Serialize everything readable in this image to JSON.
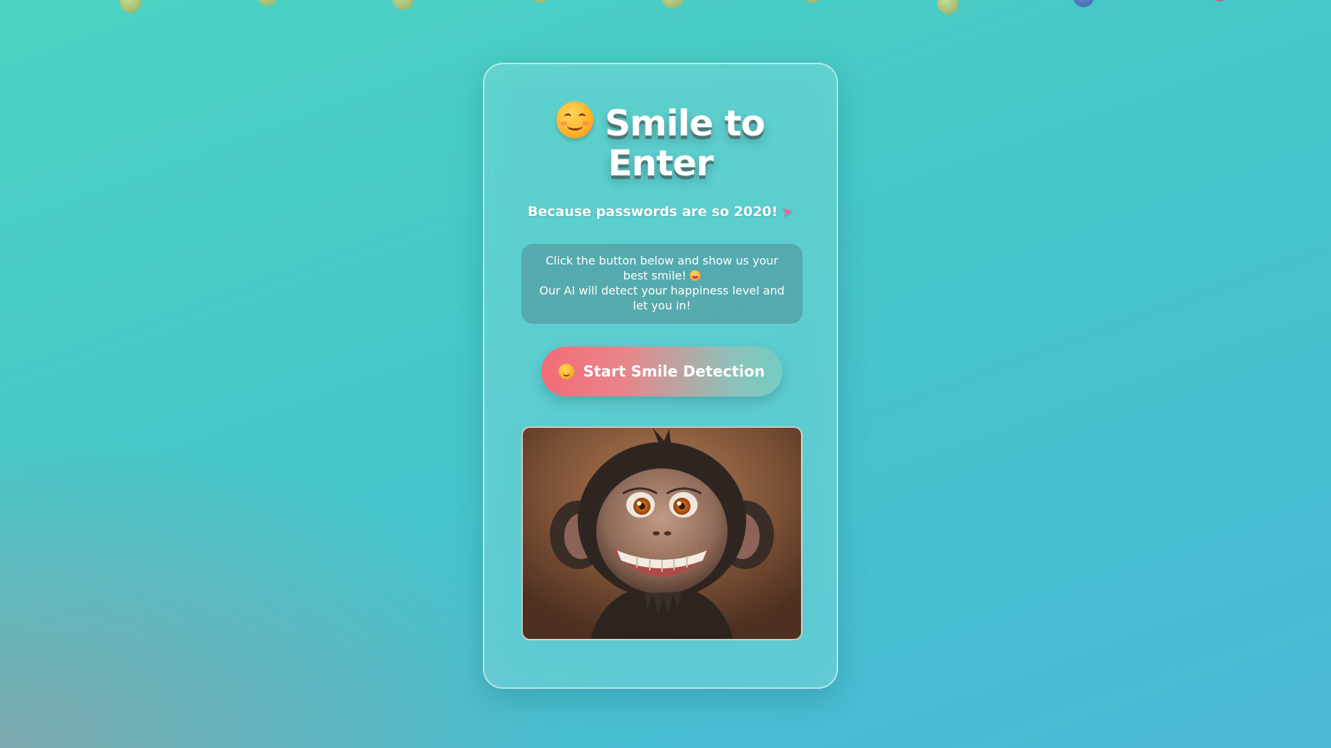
{
  "page": {
    "title_line1": "Smile to",
    "title_line2": "Enter",
    "title_icon": "smiling-face-icon",
    "subtitle": "Because passwords are so 2020!",
    "subtitle_icon": "rocket-icon"
  },
  "info": {
    "line1": "Click the button below and show us your best smile!",
    "line1_icon": "grinning-tongue-icon",
    "line2": "Our AI will detect your happiness level and let you in!"
  },
  "button": {
    "label": "Start Smile Detection",
    "icon": "smiling-face-icon"
  },
  "image": {
    "alt": "smiling monkey illustration"
  },
  "background": {
    "floating_emojis": 9
  },
  "colors": {
    "background_start": "#4cd3c2",
    "background_end": "#4ab9d6",
    "button_start": "#f26b78",
    "button_end": "#74ccc3",
    "text": "#ffffff"
  }
}
